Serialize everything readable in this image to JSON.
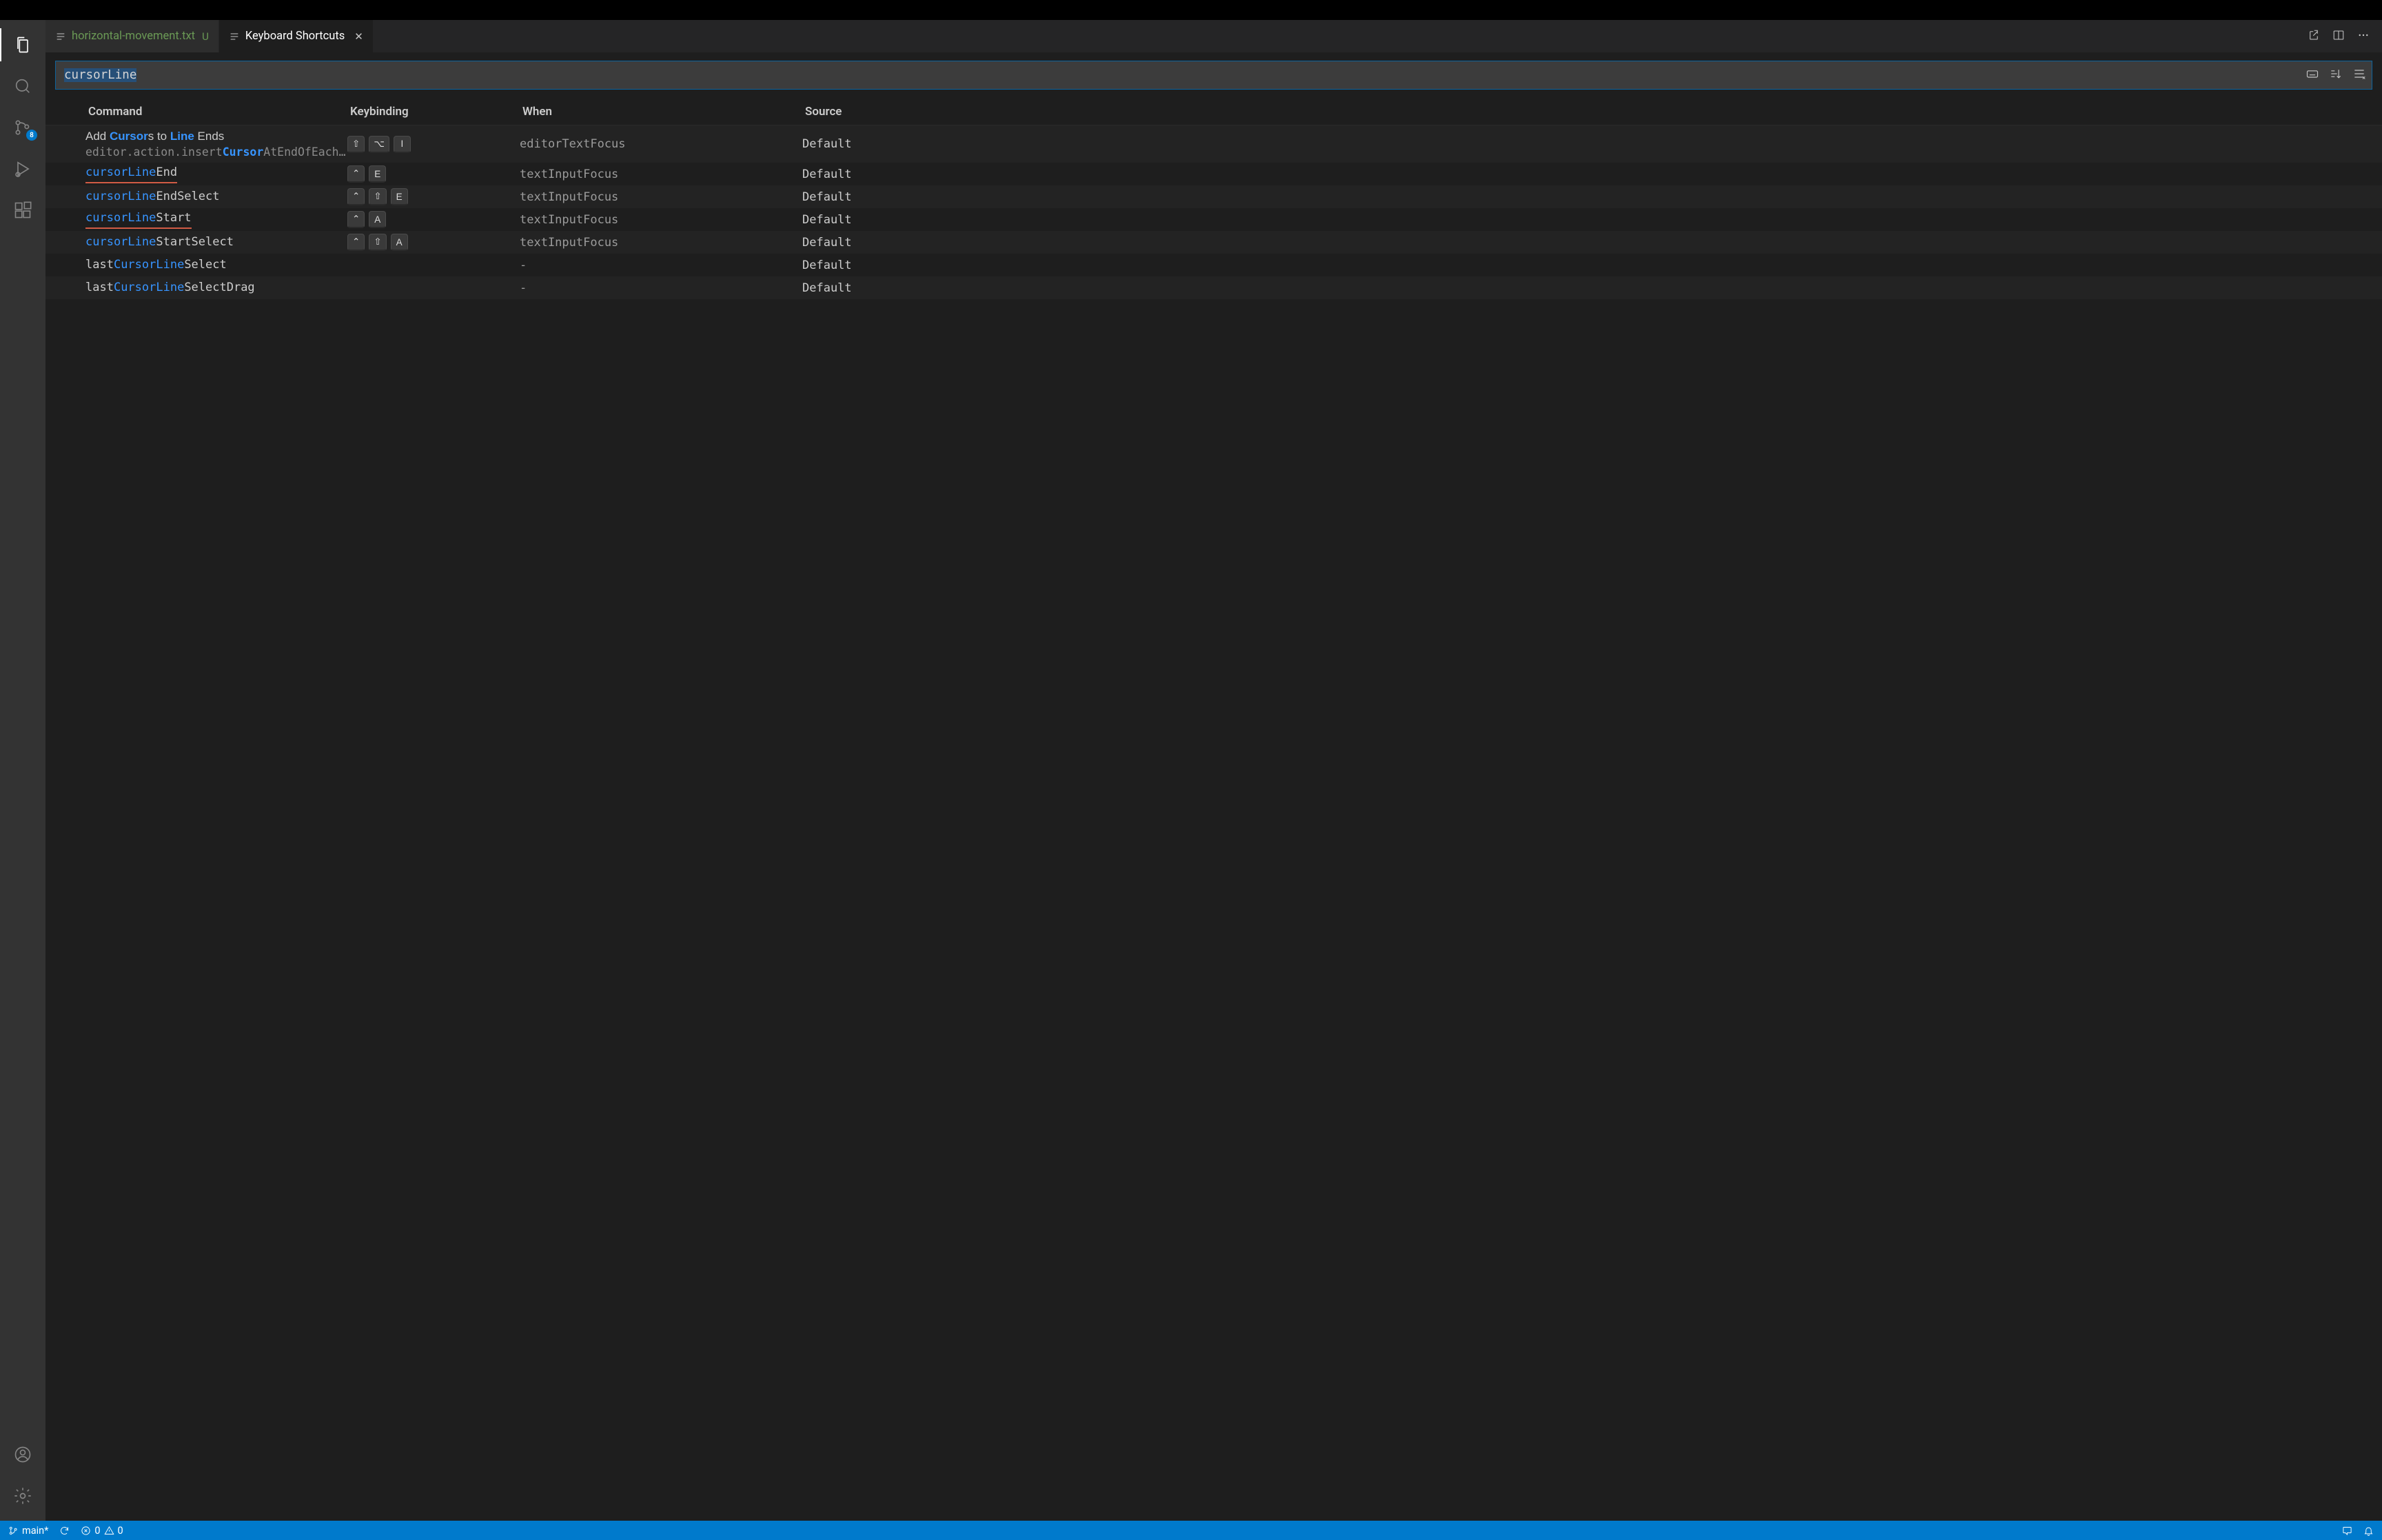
{
  "activity_bar": {
    "scm_badge": "8"
  },
  "tabs": [
    {
      "label": "horizontal-movement.txt",
      "modified_marker": "U",
      "active": false,
      "color": "#6a9955"
    },
    {
      "label": "Keyboard Shortcuts",
      "active": true
    }
  ],
  "search": {
    "value": "cursorLine"
  },
  "columns": {
    "command": "Command",
    "keybinding": "Keybinding",
    "when": "When",
    "source": "Source"
  },
  "rows": [
    {
      "cmd_html": "Add <span class='hl'>Cursor</span>s to <span class='hl'>Line</span> Ends",
      "sub_html": "editor.action.insert<span class='hl'>Cursor</span>AtEndOfEach…",
      "keys": [
        "⇧",
        "⌥",
        "I"
      ],
      "when": "editorTextFocus",
      "source": "Default",
      "tall": true
    },
    {
      "cmd_html": "<span class='underline-red'><span class='hl'>cursorLine</span>End</span>",
      "mono": true,
      "keys": [
        "⌃",
        "E"
      ],
      "when": "textInputFocus",
      "source": "Default"
    },
    {
      "cmd_html": "<span class='hl'>cursorLine</span>EndSelect",
      "mono": true,
      "keys": [
        "⌃",
        "⇧",
        "E"
      ],
      "when": "textInputFocus",
      "source": "Default"
    },
    {
      "cmd_html": "<span class='underline-red'><span class='hl'>cursorLine</span>Start</span>",
      "mono": true,
      "keys": [
        "⌃",
        "A"
      ],
      "when": "textInputFocus",
      "source": "Default"
    },
    {
      "cmd_html": "<span class='hl'>cursorLine</span>StartSelect",
      "mono": true,
      "keys": [
        "⌃",
        "⇧",
        "A"
      ],
      "when": "textInputFocus",
      "source": "Default"
    },
    {
      "cmd_html": "last<span class='hl'>CursorLine</span>Select",
      "mono": true,
      "keys": [],
      "when": "-",
      "source": "Default"
    },
    {
      "cmd_html": "last<span class='hl'>CursorLine</span>SelectDrag",
      "mono": true,
      "keys": [],
      "when": "-",
      "source": "Default"
    }
  ],
  "status": {
    "branch": "main*",
    "errors": "0",
    "warnings": "0"
  }
}
